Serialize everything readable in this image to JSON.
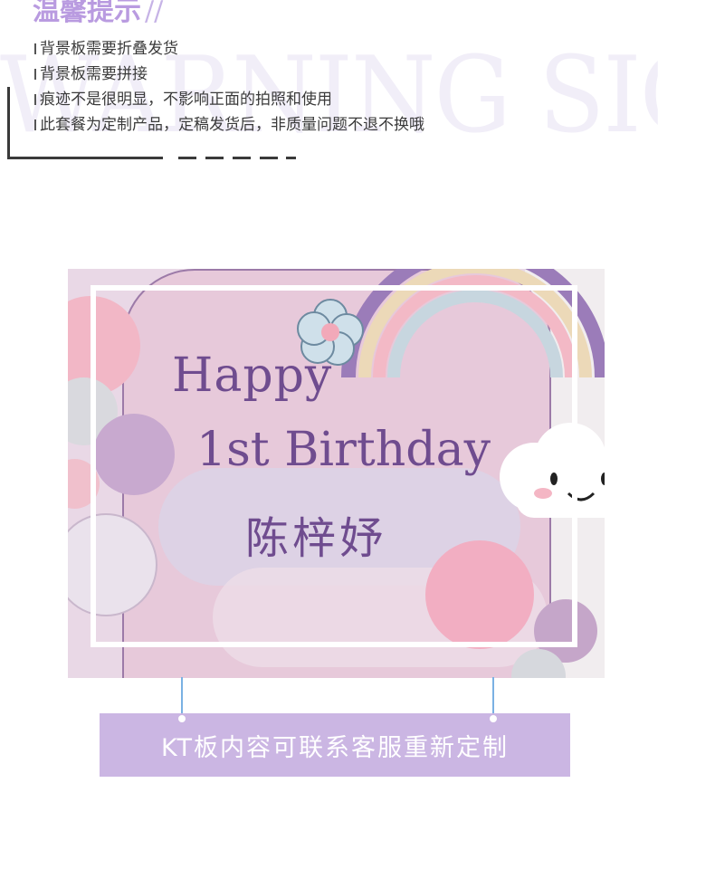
{
  "header": {
    "title": "温馨提示",
    "title_decoration": "//",
    "watermark_text": "WARNING SIGN",
    "notes": [
      "背景板需要折叠发货",
      "背景板需要拼接",
      "痕迹不是很明显，不影响正面的拍照和使用",
      "此套餐为定制产品，定稿发货后，非质量问题不退不换哦"
    ]
  },
  "photo": {
    "board_line1": "Happy",
    "board_line2": "1st Birthday",
    "board_name": "陈梓妤"
  },
  "caption": {
    "text": "KT板内容可联系客服重新定制"
  },
  "colors": {
    "title": "#b99be0",
    "caption_bg": "#cbb6e3",
    "board_text": "#6f4c8f",
    "connector": "#7ab1e3"
  }
}
